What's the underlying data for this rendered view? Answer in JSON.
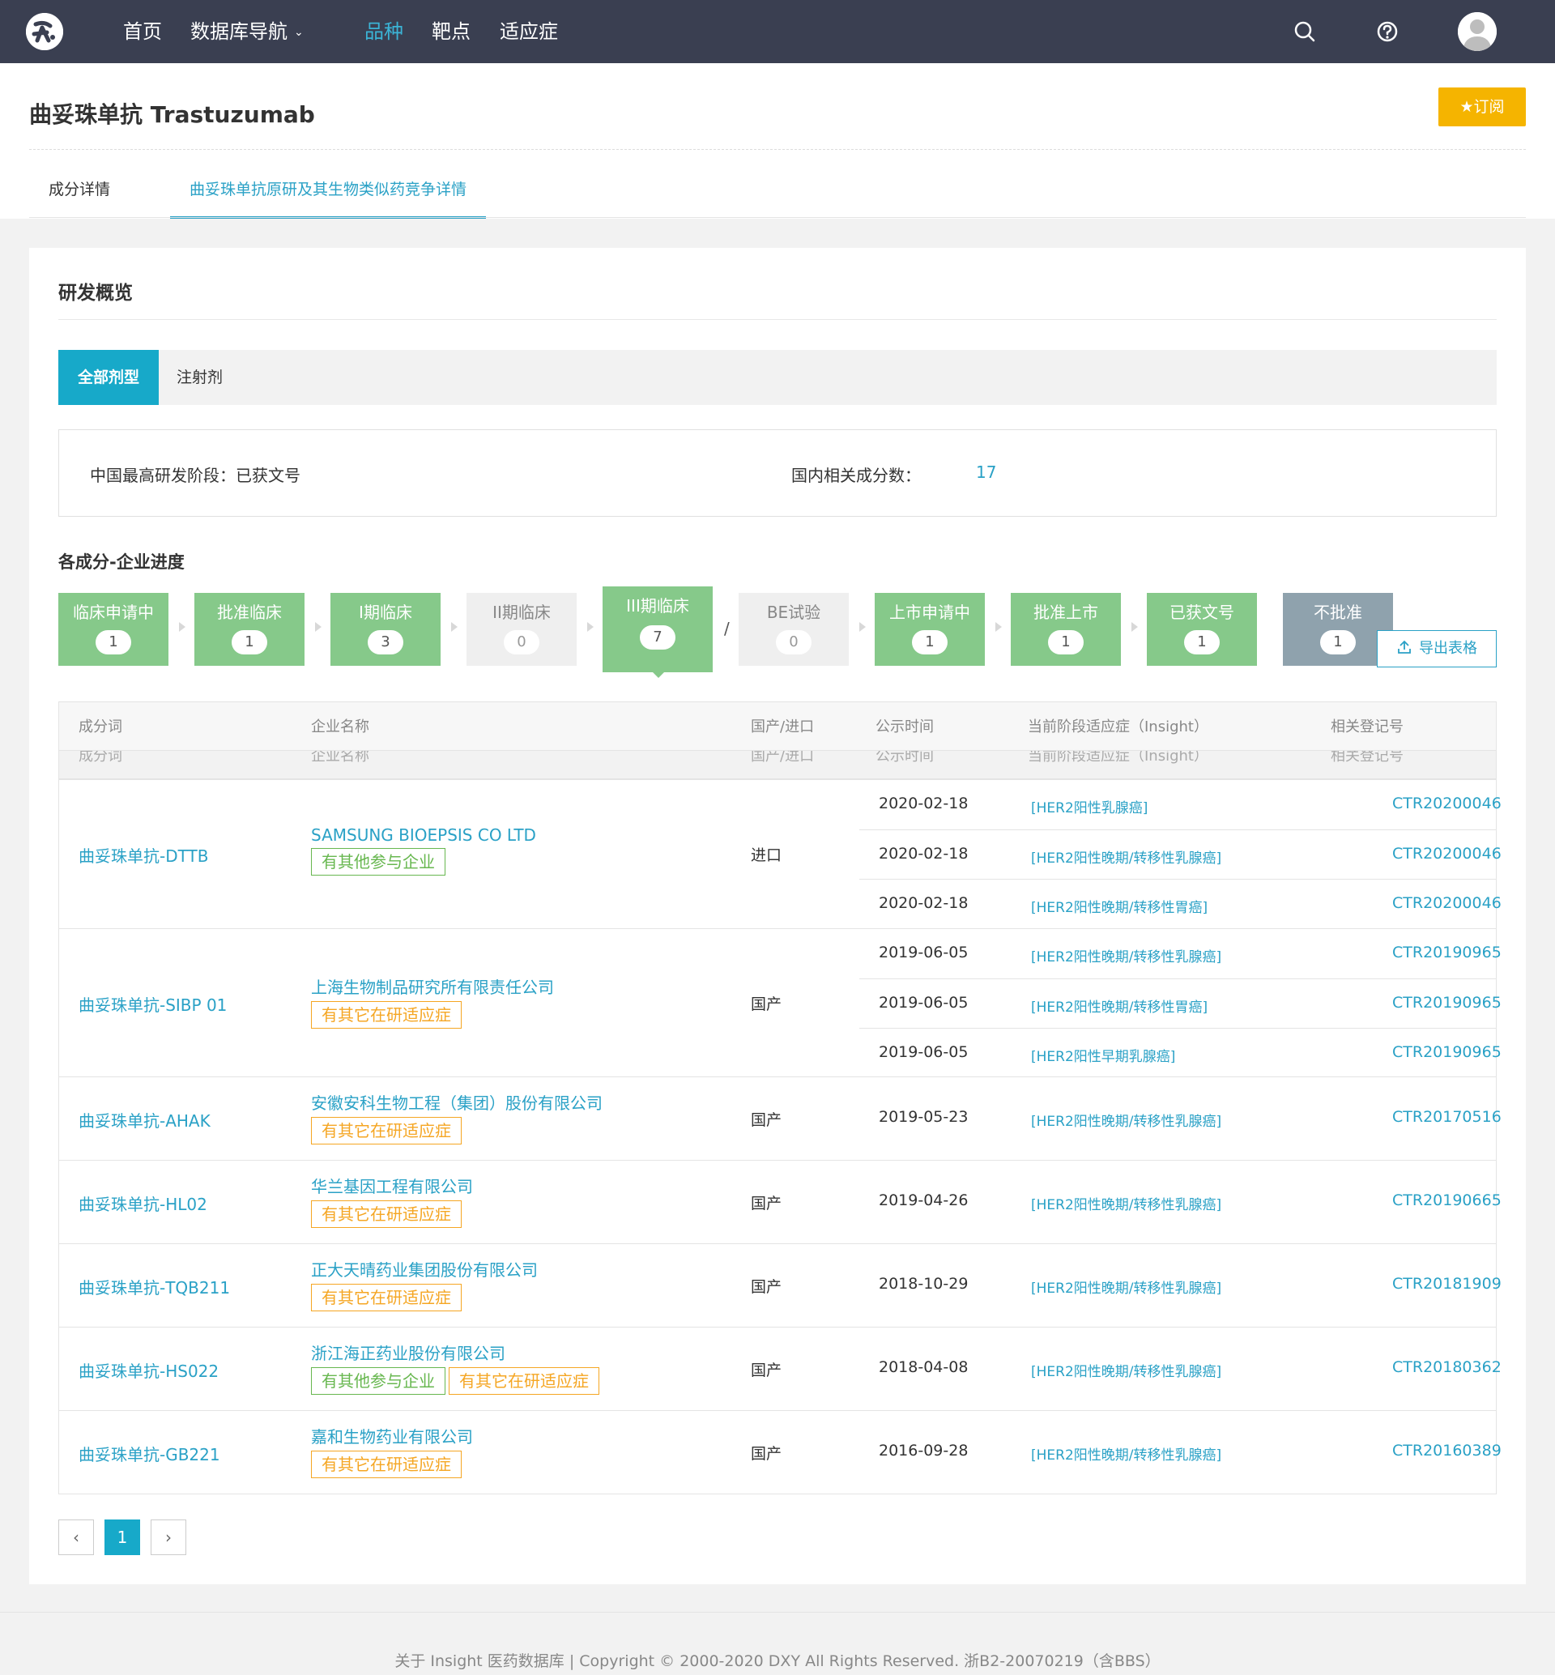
{
  "nav": {
    "items": [
      "首页",
      "数据库导航",
      "品种",
      "靶点",
      "适应症"
    ],
    "dropdown_caret": "⌄",
    "icons": [
      "search-icon",
      "help-icon",
      "avatar"
    ]
  },
  "header": {
    "title": "曲妥珠单抗 Trastuzumab",
    "subscribe_label": "订阅",
    "subscribe_icon": "star-icon",
    "tabs": [
      "成分详情",
      "曲妥珠单抗原研及其生物类似药竞争详情"
    ]
  },
  "overview": {
    "title": "研发概览",
    "form_tabs": [
      "全部剂型",
      "注射剂"
    ],
    "highest_stage_label": "中国最高研发阶段：已获文号",
    "ingredient_count_label": "国内相关成分数：",
    "ingredient_count": "17"
  },
  "progress": {
    "title": "各成分-企业进度",
    "separator": "/",
    "stages": [
      {
        "label": "临床申请中",
        "count": "1"
      },
      {
        "label": "批准临床",
        "count": "1"
      },
      {
        "label": "I期临床",
        "count": "3"
      },
      {
        "label": "II期临床",
        "count": "0"
      },
      {
        "label": "III期临床",
        "count": "7"
      },
      {
        "label": "BE试验",
        "count": "0"
      },
      {
        "label": "上市申请中",
        "count": "1"
      },
      {
        "label": "批准上市",
        "count": "1"
      },
      {
        "label": "已获文号",
        "count": "1"
      },
      {
        "label": "不批准",
        "count": "1"
      }
    ],
    "export_label": "导出表格"
  },
  "table": {
    "headers": [
      "成分词",
      "企业名称",
      "国产/进口",
      "公示时间",
      "当前阶段适应症（Insight）",
      "相关登记号"
    ],
    "groups": [
      {
        "name": "曲妥珠单抗-DTTB",
        "company": "SAMSUNG BIOEPSIS CO LTD",
        "tags": [
          {
            "text": "有其他参与企业",
            "color": "green"
          }
        ],
        "origin": "进口",
        "rows": [
          {
            "date": "2020-02-18",
            "indication": "[HER2阳性乳腺癌]",
            "reg": "CTR20200046"
          },
          {
            "date": "2020-02-18",
            "indication": "[HER2阳性晚期/转移性乳腺癌]",
            "reg": "CTR20200046"
          },
          {
            "date": "2020-02-18",
            "indication": "[HER2阳性晚期/转移性胃癌]",
            "reg": "CTR20200046"
          }
        ]
      },
      {
        "name": "曲妥珠单抗-SIBP 01",
        "company": "上海生物制品研究所有限责任公司",
        "tags": [
          {
            "text": "有其它在研适应症",
            "color": "orange"
          }
        ],
        "origin": "国产",
        "rows": [
          {
            "date": "2019-06-05",
            "indication": "[HER2阳性晚期/转移性乳腺癌]",
            "reg": "CTR20190965"
          },
          {
            "date": "2019-06-05",
            "indication": "[HER2阳性晚期/转移性胃癌]",
            "reg": "CTR20190965"
          },
          {
            "date": "2019-06-05",
            "indication": "[HER2阳性早期乳腺癌]",
            "reg": "CTR20190965"
          }
        ]
      },
      {
        "name": "曲妥珠单抗-AHAK",
        "company": "安徽安科生物工程（集团）股份有限公司",
        "tags": [
          {
            "text": "有其它在研适应症",
            "color": "orange"
          }
        ],
        "origin": "国产",
        "rows": [
          {
            "date": "2019-05-23",
            "indication": "[HER2阳性晚期/转移性乳腺癌]",
            "reg": "CTR20170516"
          }
        ]
      },
      {
        "name": "曲妥珠单抗-HL02",
        "company": "华兰基因工程有限公司",
        "tags": [
          {
            "text": "有其它在研适应症",
            "color": "orange"
          }
        ],
        "origin": "国产",
        "rows": [
          {
            "date": "2019-04-26",
            "indication": "[HER2阳性晚期/转移性乳腺癌]",
            "reg": "CTR20190665"
          }
        ]
      },
      {
        "name": "曲妥珠单抗-TQB211",
        "company": "正大天晴药业集团股份有限公司",
        "tags": [
          {
            "text": "有其它在研适应症",
            "color": "orange"
          }
        ],
        "origin": "国产",
        "rows": [
          {
            "date": "2018-10-29",
            "indication": "[HER2阳性晚期/转移性乳腺癌]",
            "reg": "CTR20181909"
          }
        ]
      },
      {
        "name": "曲妥珠单抗-HS022",
        "company": "浙江海正药业股份有限公司",
        "tags": [
          {
            "text": "有其他参与企业",
            "color": "green"
          },
          {
            "text": "有其它在研适应症",
            "color": "orange"
          }
        ],
        "origin": "国产",
        "rows": [
          {
            "date": "2018-04-08",
            "indication": "[HER2阳性晚期/转移性乳腺癌]",
            "reg": "CTR20180362"
          }
        ]
      },
      {
        "name": "曲妥珠单抗-GB221",
        "company": "嘉和生物药业有限公司",
        "tags": [
          {
            "text": "有其它在研适应症",
            "color": "orange"
          }
        ],
        "origin": "国产",
        "rows": [
          {
            "date": "2016-09-28",
            "indication": "[HER2阳性晚期/转移性乳腺癌]",
            "reg": "CTR20160389"
          }
        ]
      }
    ]
  },
  "pagination": {
    "prev": "‹",
    "current": "1",
    "next": "›"
  },
  "footer": {
    "text": "关于 Insight 医药数据库 | Copyright © 2000-2020 DXY All Rights Reserved. 浙B2-20070219（含BBS）"
  },
  "colors": {
    "accent": "#2aa1c6",
    "nav_bg": "#3a3f51",
    "stage_green": "#86c98a",
    "subscribe": "#f5b400"
  }
}
